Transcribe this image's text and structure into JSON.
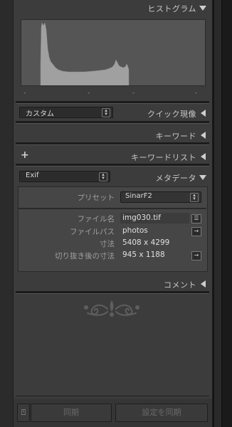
{
  "histogram": {
    "title": "ヒストグラム",
    "ticks": [
      "-",
      "-",
      "-",
      "-"
    ]
  },
  "quick_develop": {
    "preset_value": "カスタム",
    "title": "クイック現像"
  },
  "keywording": {
    "title": "キーワード"
  },
  "keyword_list": {
    "add_symbol": "+",
    "title": "キーワードリスト"
  },
  "metadata": {
    "view_value": "Exif",
    "title": "メタデータ",
    "preset_label": "プリセット",
    "preset_value": "SinarF2",
    "fields": [
      {
        "label": "ファイル名",
        "value": "img030.tif",
        "button": "☰"
      },
      {
        "label": "ファイルパス",
        "value": "photos",
        "button": "→"
      },
      {
        "label": "寸法",
        "value": "5408 x 4299",
        "button": ""
      },
      {
        "label": "切り抜き後の寸法",
        "value": "945 x 1188",
        "button": "→"
      }
    ]
  },
  "comments": {
    "title": "コメント"
  },
  "footer": {
    "toggle_symbol": "⍞",
    "sync_label": "同期",
    "sync_settings_label": "設定を同期"
  },
  "colors": {
    "panel_bg": "#3c3c3c",
    "histogram_fill": "#a0a0a0",
    "histogram_bg": "#555555"
  }
}
